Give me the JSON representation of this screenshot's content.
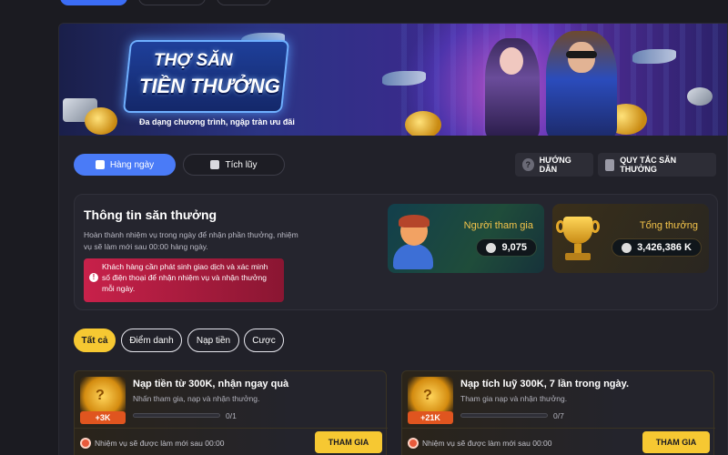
{
  "banner": {
    "title_line1": "THỢ SĂN",
    "title_line2": "TIỀN THƯỞNG",
    "subtitle": "Đa dạng chương trình, ngập tràn ưu đãi"
  },
  "mode_tabs": [
    {
      "label": "Hàng ngày",
      "active": true
    },
    {
      "label": "Tích lũy",
      "active": false
    }
  ],
  "header_buttons": {
    "guide": "HƯỚNG DẪN",
    "rules": "QUY TẮC SĂN THƯỞNG"
  },
  "info": {
    "title": "Thông tin săn thưởng",
    "description": "Hoàn thành nhiệm vụ trong ngày để nhận phần thưởng, nhiệm vụ sẽ làm mới sau 00:00 hàng ngày.",
    "warning": "Khách hàng cần phát sinh giao dịch và xác minh số điện thoại để nhận nhiệm vụ và nhận thưởng mỗi ngày."
  },
  "stats": {
    "players_label": "Người tham gia",
    "players_value": "9,075",
    "prize_label": "Tổng thưởng",
    "prize_value": "3,426,386 K"
  },
  "filters": [
    {
      "label": "Tất cả",
      "active": true
    },
    {
      "label": "Điểm danh",
      "active": false
    },
    {
      "label": "Nạp tiền",
      "active": false
    },
    {
      "label": "Cược",
      "active": false
    }
  ],
  "tasks": [
    {
      "bonus": "+3K",
      "title": "Nạp tiền từ 300K, nhận ngay quà",
      "desc": "Nhấn tham gia, nạp và nhận thưởng.",
      "progress": "0/1",
      "progress_fraction": 0,
      "reset_text": "Nhiệm vụ sẽ được làm mới sau 00:00",
      "button": "THAM GIA"
    },
    {
      "bonus": "+21K",
      "title": "Nạp tích luỹ 300K, 7 lần trong ngày.",
      "desc": "Tham gia nạp và nhận thưởng.",
      "progress": "0/7",
      "progress_fraction": 0,
      "reset_text": "Nhiệm vụ sẽ được làm mới sau 00:00",
      "button": "THAM GIA"
    }
  ],
  "colors": {
    "accent_blue": "#4a7bf7",
    "accent_yellow": "#f6c832",
    "warning_red": "#c8214a",
    "background": "#1b1b21"
  },
  "icons": [
    "calendar-icon",
    "accumulate-icon",
    "help-icon",
    "document-icon",
    "info-icon",
    "user-group-icon",
    "coin-icon",
    "clock-icon"
  ]
}
